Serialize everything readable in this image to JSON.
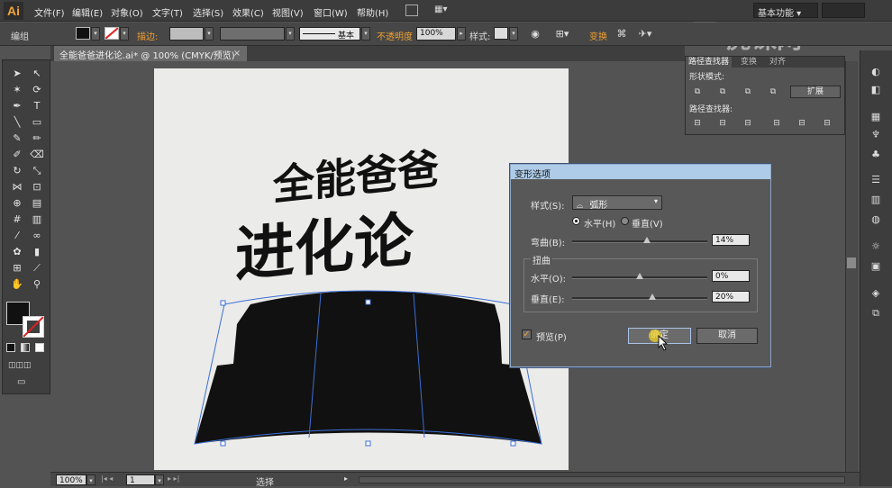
{
  "app": {
    "logo": "Ai"
  },
  "menubar": {
    "items": [
      "文件(F)",
      "编辑(E)",
      "对象(O)",
      "文字(T)",
      "选择(S)",
      "效果(C)",
      "视图(V)",
      "窗口(W)",
      "帮助(H)"
    ],
    "workspace": "基本功能",
    "watermark": "虎课网"
  },
  "controlbar": {
    "selection_label": "编组",
    "stroke_label": "描边:",
    "stroke_style": "基本",
    "opacity_label": "不透明度",
    "opacity_value": "100%",
    "style_label": "样式:",
    "transform_label": "变换"
  },
  "document": {
    "tab_title": "全能爸爸进化论.ai* @ 100% (CMYK/预览)",
    "close": "×"
  },
  "artwork": {
    "line1": "全能爸爸",
    "line2": "进化论"
  },
  "pathfinder": {
    "tabs": [
      "路径查找器",
      "变换",
      "对齐"
    ],
    "shape_modes_label": "形状模式:",
    "expand_label": "扩展",
    "pathfinders_label": "路径查找器:"
  },
  "dialog": {
    "title": "变形选项",
    "style_label": "样式(S):",
    "style_value": "弧形",
    "horizontal_label": "水平(H)",
    "vertical_label": "垂直(V)",
    "orientation_selected": "horizontal",
    "bend_label": "弯曲(B):",
    "bend_value": "14%",
    "distortion_label": "扭曲",
    "h_distortion_label": "水平(O):",
    "h_distortion_value": "0%",
    "v_distortion_label": "垂直(E):",
    "v_distortion_value": "20%",
    "preview_label": "预览(P)",
    "preview_checked": true,
    "ok_label": "确定",
    "cancel_label": "取消"
  },
  "statusbar": {
    "zoom": "100%",
    "artboard": "1",
    "status": "选择"
  }
}
